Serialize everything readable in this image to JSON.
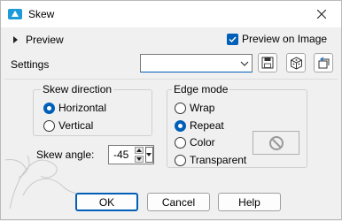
{
  "window": {
    "title": "Skew"
  },
  "preview": {
    "label": "Preview",
    "preview_on_image_label": "Preview on Image",
    "preview_on_image_checked": true
  },
  "settings": {
    "label": "Settings",
    "value": ""
  },
  "skew_direction": {
    "title": "Skew direction",
    "options": [
      {
        "label": "Horizontal",
        "selected": true
      },
      {
        "label": "Vertical",
        "selected": false
      }
    ]
  },
  "edge_mode": {
    "title": "Edge mode",
    "options": [
      {
        "label": "Wrap",
        "selected": false
      },
      {
        "label": "Repeat",
        "selected": true
      },
      {
        "label": "Color",
        "selected": false
      },
      {
        "label": "Transparent",
        "selected": false
      }
    ]
  },
  "skew_angle": {
    "label": "Skew angle:",
    "value": "-45"
  },
  "buttons": {
    "ok": "OK",
    "cancel": "Cancel",
    "help": "Help"
  },
  "colors": {
    "accent": "#005fb8",
    "background": "#f0f0f0"
  }
}
